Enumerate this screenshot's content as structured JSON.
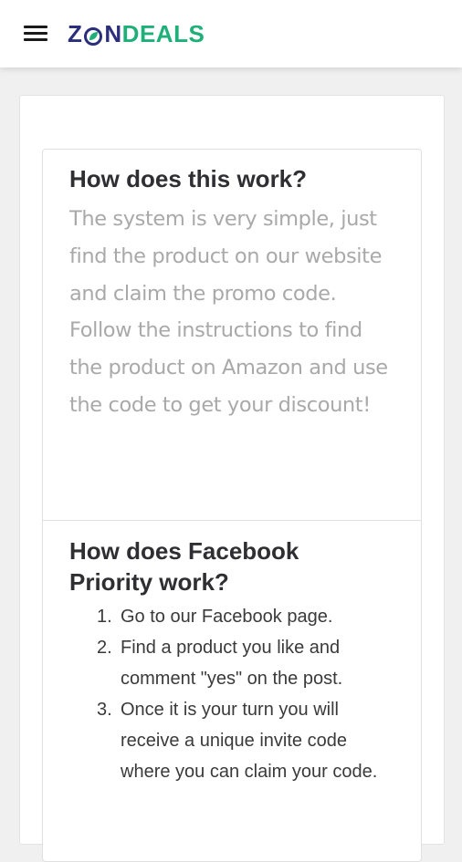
{
  "header": {
    "logo": {
      "part1": "Z",
      "part2": "N",
      "part3": "DEALS",
      "brand_color_dark": "#2b2e7a",
      "brand_color_green": "#1fb07a"
    },
    "menu_icon": "hamburger-icon"
  },
  "main": {
    "faq": [
      {
        "title": "How does this work?",
        "body": "The system is very simple, just find the product on our website and claim the promo code. Follow the instructions to find the product on Amazon and use the code to get your discount!"
      },
      {
        "title": "How does Facebook Priority work?",
        "steps": [
          {
            "num": "1.",
            "text": "Go to our Facebook page."
          },
          {
            "num": "2.",
            "text": "Find a product you like and comment \"yes\" on the post."
          },
          {
            "num": "3.",
            "text": "Once it is your turn you will receive a unique invite code where you can claim your code."
          }
        ]
      }
    ]
  }
}
